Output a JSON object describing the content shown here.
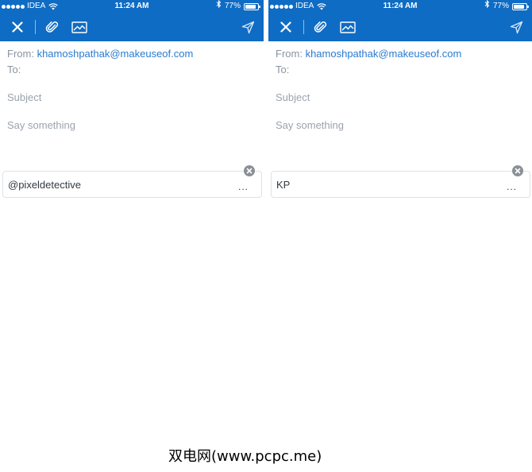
{
  "status_bar": {
    "carrier": "IDEA",
    "time": "11:24 AM",
    "battery_percent": "77%",
    "battery_level": 0.77
  },
  "icons": {
    "close": "close-icon",
    "attach": "paperclip-icon",
    "image": "image-icon",
    "send": "send-icon",
    "remove": "remove-circle-icon",
    "wifi": "wifi-icon",
    "bluetooth": "bluetooth-icon",
    "battery": "battery-icon"
  },
  "colors": {
    "toolbar": "#0f6cc4",
    "link": "#2a7ad0",
    "placeholder": "#9aa3ad"
  },
  "panels": [
    {
      "from_label": "From:",
      "from_address": "khamoshpathak@makeuseof.com",
      "to_label": "To:",
      "subject_placeholder": "Subject",
      "body_placeholder": "Say something",
      "signature": "@pixeldetective",
      "more_label": "..."
    },
    {
      "from_label": "From:",
      "from_address": "khamoshpathak@makeuseof.com",
      "to_label": "To:",
      "subject_placeholder": "Subject",
      "body_placeholder": "Say something",
      "signature": "KP",
      "more_label": "..."
    }
  ],
  "watermark": "双电网(www.pcpc.me)"
}
